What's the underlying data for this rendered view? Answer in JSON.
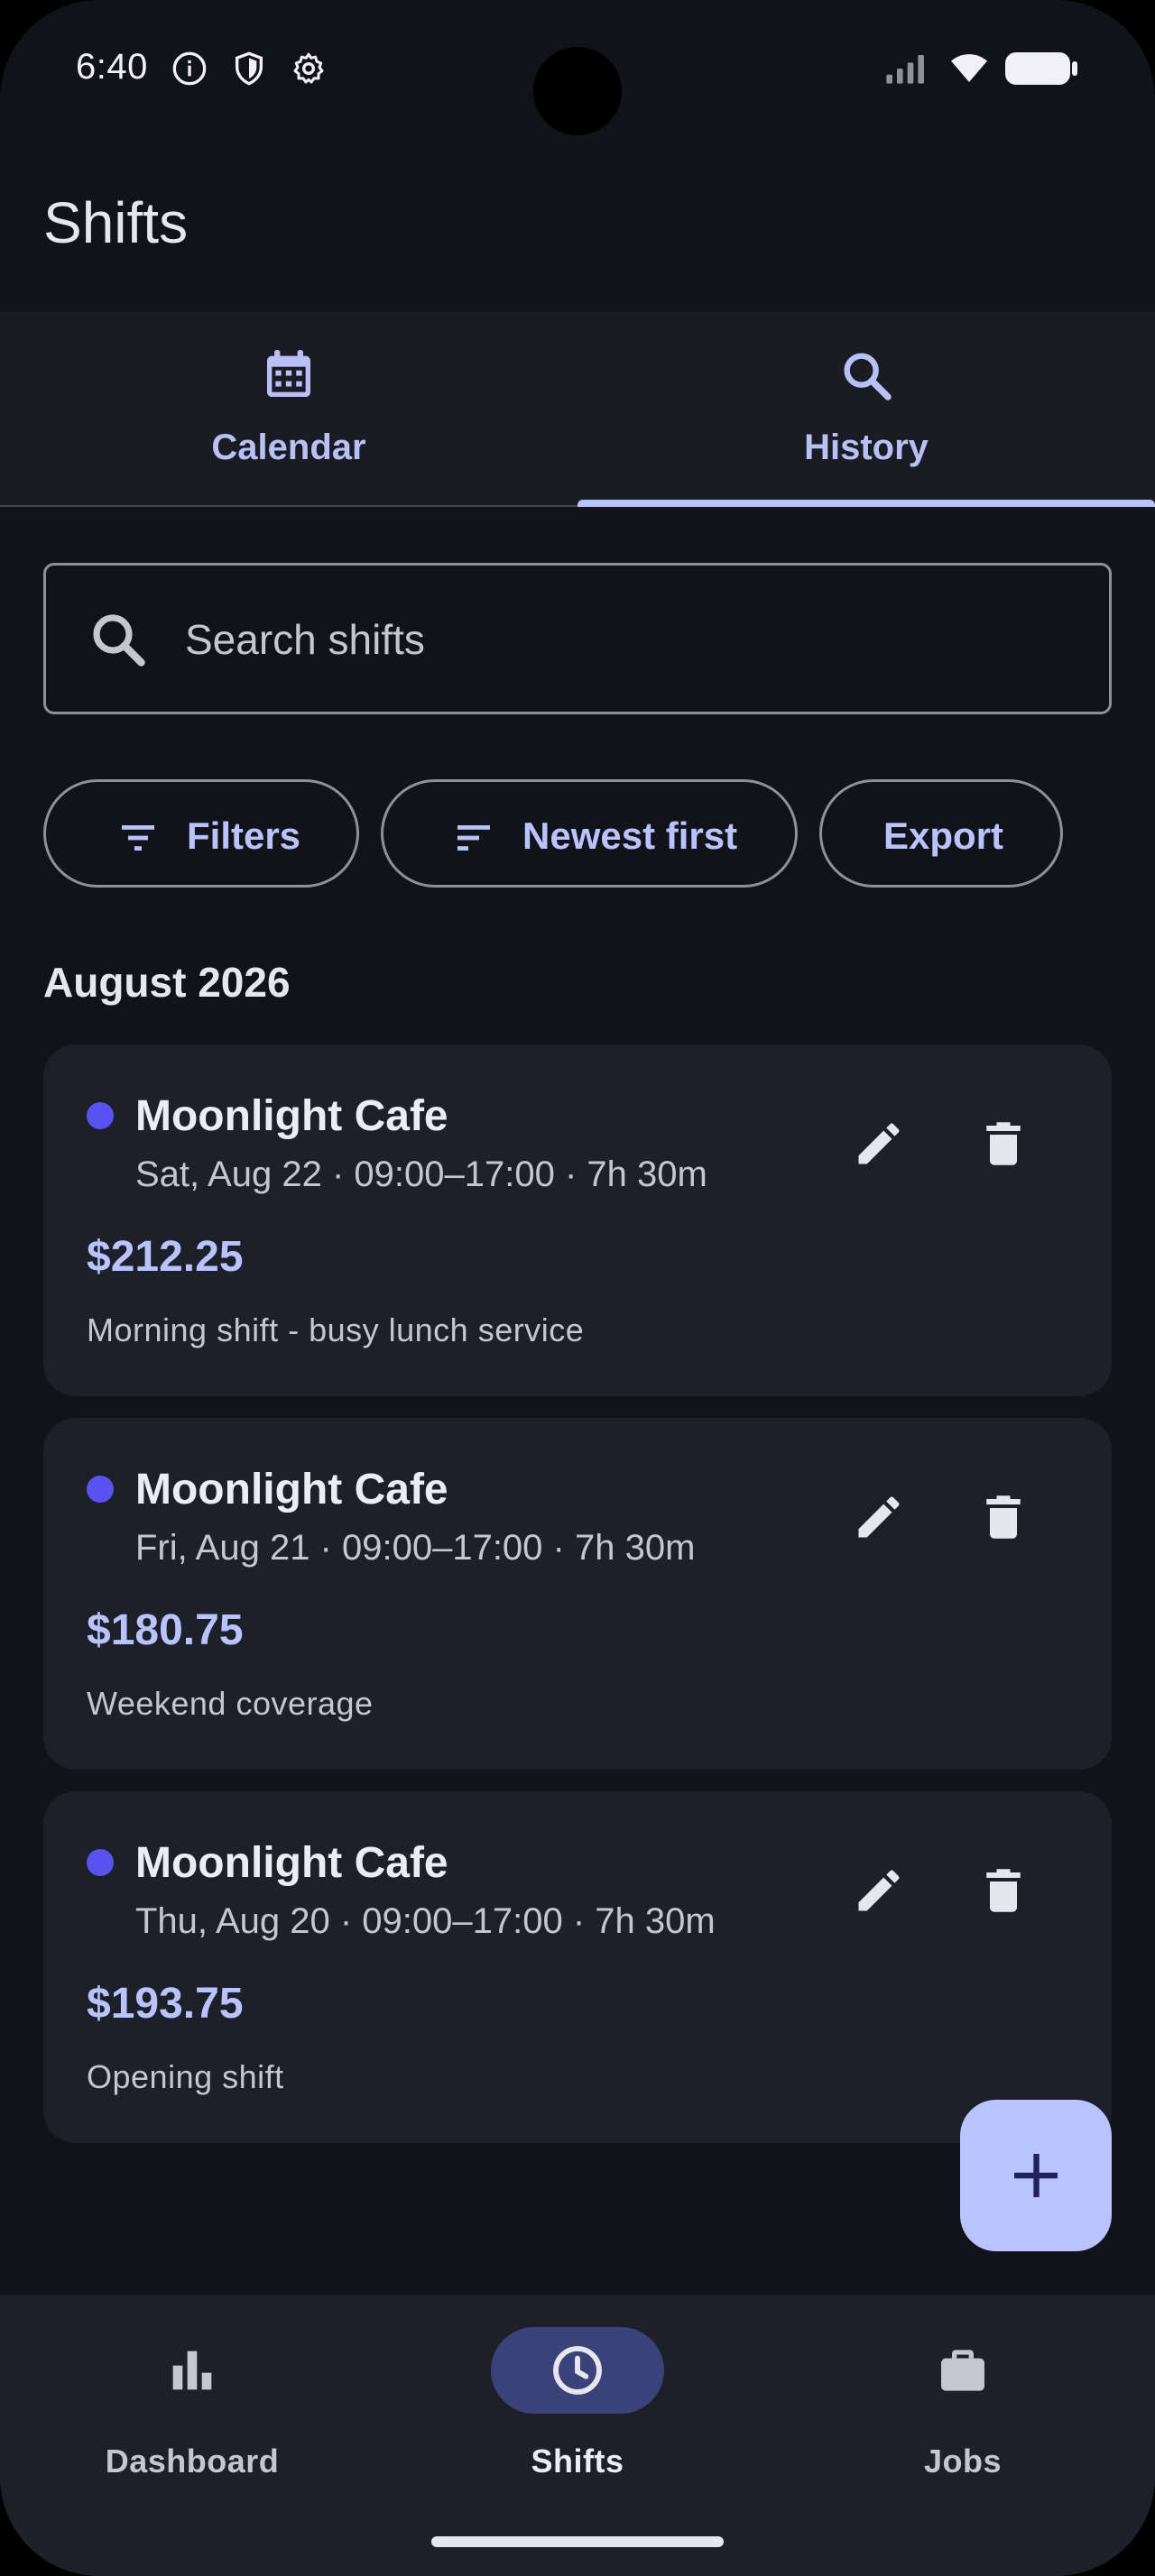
{
  "status_bar": {
    "time": "6:40",
    "icons": [
      "info-icon",
      "shield-icon",
      "settings-icon",
      "signal-icon",
      "wifi-icon",
      "battery-icon"
    ]
  },
  "app_bar": {
    "title": "Shifts"
  },
  "tabs": [
    {
      "label": "Calendar",
      "icon": "calendar-icon",
      "selected": false
    },
    {
      "label": "History",
      "icon": "search-icon",
      "selected": true
    }
  ],
  "search": {
    "placeholder": "Search shifts",
    "value": ""
  },
  "chips": {
    "filters": {
      "label": "Filters",
      "icon": "filter-icon"
    },
    "sort": {
      "label": "Newest first",
      "icon": "sort-icon"
    },
    "export": {
      "label": "Export"
    }
  },
  "section": {
    "title": "August 2026"
  },
  "shifts": [
    {
      "job": "Moonlight Cafe",
      "meta": "Sat, Aug 22 · 09:00–17:00 · 7h 30m",
      "amount": "$212.25",
      "note": "Morning shift - busy lunch service"
    },
    {
      "job": "Moonlight Cafe",
      "meta": "Fri, Aug 21 · 09:00–17:00 · 7h 30m",
      "amount": "$180.75",
      "note": "Weekend coverage"
    },
    {
      "job": "Moonlight Cafe",
      "meta": "Thu, Aug 20 · 09:00–17:00 · 7h 30m",
      "amount": "$193.75",
      "note": "Opening shift"
    }
  ],
  "fab": {
    "icon": "add-icon"
  },
  "bottom_nav": [
    {
      "label": "Dashboard",
      "icon": "bar-chart-icon",
      "active": false
    },
    {
      "label": "Shifts",
      "icon": "clock-icon",
      "active": true
    },
    {
      "label": "Jobs",
      "icon": "briefcase-icon",
      "active": false
    }
  ],
  "colors": {
    "background": "#121318",
    "surface": "#1d2029",
    "accent": "#b9c3ff",
    "job_dot": "#5a52f0",
    "nav_active_pill": "#3b4279"
  }
}
